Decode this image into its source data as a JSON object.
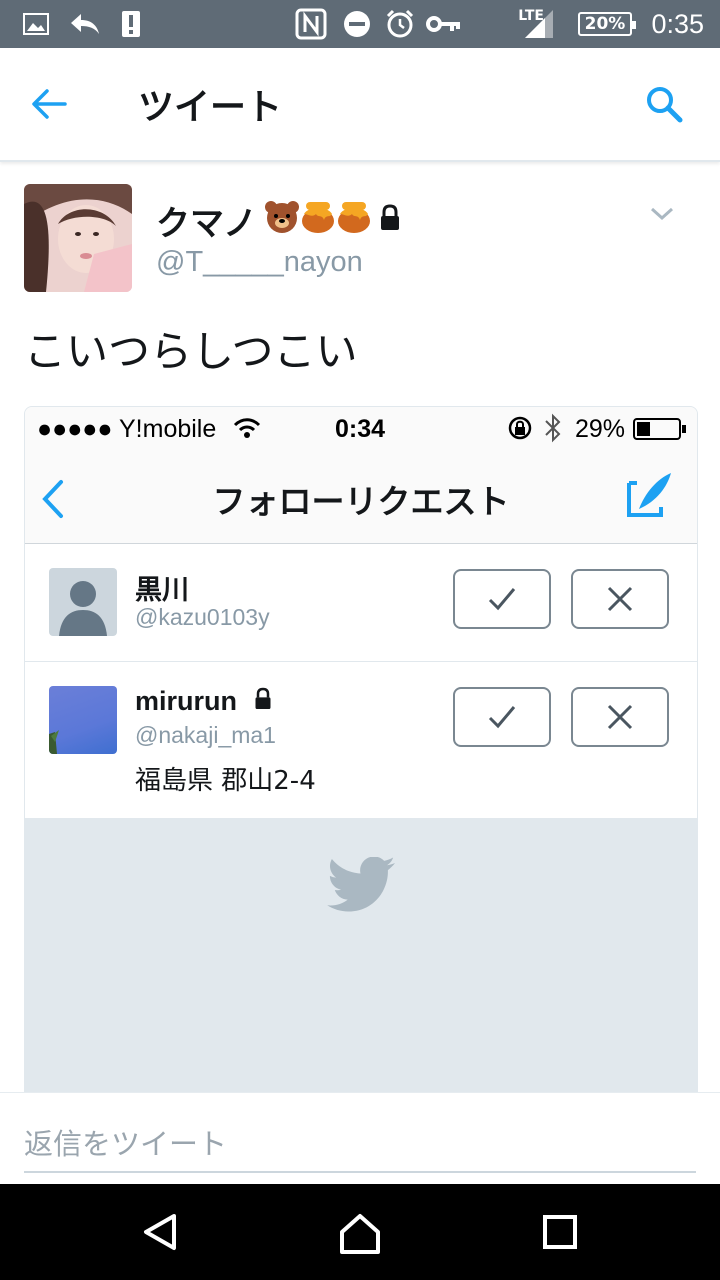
{
  "status_bar": {
    "lte": "LTE",
    "battery": "20%",
    "time": "0:35"
  },
  "header": {
    "title": "ツイート"
  },
  "tweet": {
    "display_name": "クマノ",
    "handle": "@T_____nayon",
    "text": "こいつらしつこい"
  },
  "embedded_screenshot": {
    "status": {
      "carrier": "●●●●● Y!mobile",
      "time": "0:34",
      "battery": "29%"
    },
    "title": "フォローリクエスト",
    "requests": [
      {
        "name": "黒川",
        "handle": "@kazu0103y",
        "location": ""
      },
      {
        "name": "mirurun",
        "handle": "@nakaji_ma1",
        "location": "福島県 郡山2-4"
      }
    ]
  },
  "reply": {
    "placeholder": "返信をツイート"
  },
  "colors": {
    "accent": "#1da1f2",
    "status_bar": "#5f6b76",
    "secondary_text": "#8899a6"
  }
}
